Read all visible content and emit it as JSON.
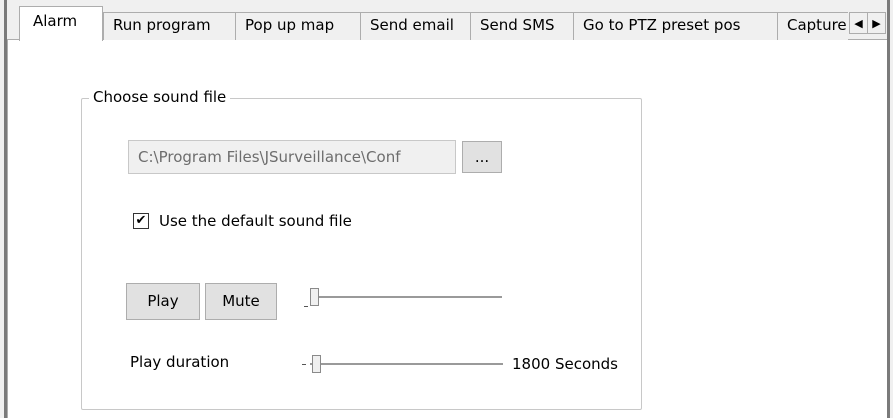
{
  "tabs": [
    {
      "label": "Alarm",
      "active": true
    },
    {
      "label": "Run program"
    },
    {
      "label": "Pop up map"
    },
    {
      "label": "Send email"
    },
    {
      "label": "Send SMS"
    },
    {
      "label": "Go to PTZ preset pos"
    },
    {
      "label": "Capture"
    }
  ],
  "tab_nav": {
    "left_icon": "◀",
    "right_icon": "▶"
  },
  "sound_group": {
    "title": "Choose sound file",
    "path_value": "C:\\Program Files\\JSurveillance\\Conf",
    "browse_label": "...",
    "use_default_label": "Use the default sound file",
    "use_default_checked": "✔",
    "play_label": "Play",
    "mute_label": "Mute",
    "volume_level": 0.0,
    "duration_label": "Play duration",
    "duration_value": "1800 Seconds",
    "duration_level": 0.0
  }
}
